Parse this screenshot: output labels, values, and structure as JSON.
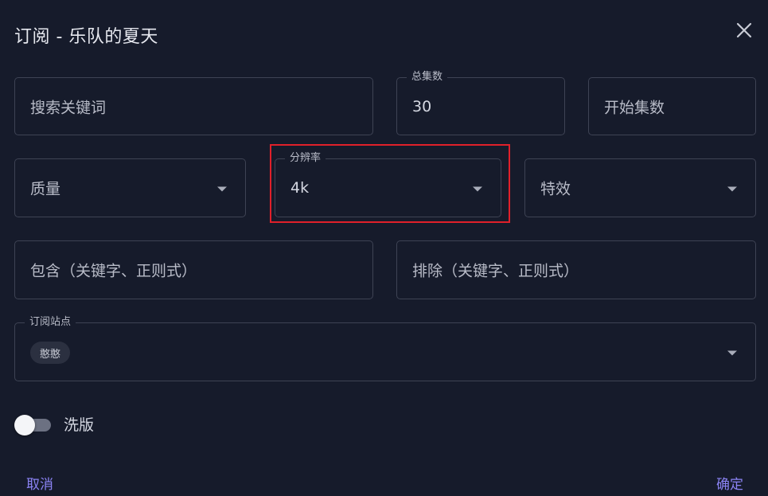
{
  "dialog": {
    "title": "订阅 - 乐队的夏天",
    "close_icon": "close-icon"
  },
  "form": {
    "keyword": {
      "placeholder": "搜索关键词"
    },
    "total_episodes": {
      "label": "总集数",
      "value": "30"
    },
    "start_episode": {
      "placeholder": "开始集数"
    },
    "quality": {
      "placeholder": "质量"
    },
    "resolution": {
      "label": "分辨率",
      "value": "4k"
    },
    "effect": {
      "placeholder": "特效"
    },
    "include": {
      "placeholder": "包含（关键字、正则式）"
    },
    "exclude": {
      "placeholder": "排除（关键字、正则式）"
    },
    "sites": {
      "label": "订阅站点",
      "chips": [
        "憨憨"
      ]
    },
    "wash": {
      "label": "洗版",
      "enabled": false
    }
  },
  "actions": {
    "cancel": "取消",
    "confirm": "确定"
  },
  "colors": {
    "background": "#161b2b",
    "border": "#3e4354",
    "accent": "#8b83f4",
    "highlight": "#e0202a"
  }
}
